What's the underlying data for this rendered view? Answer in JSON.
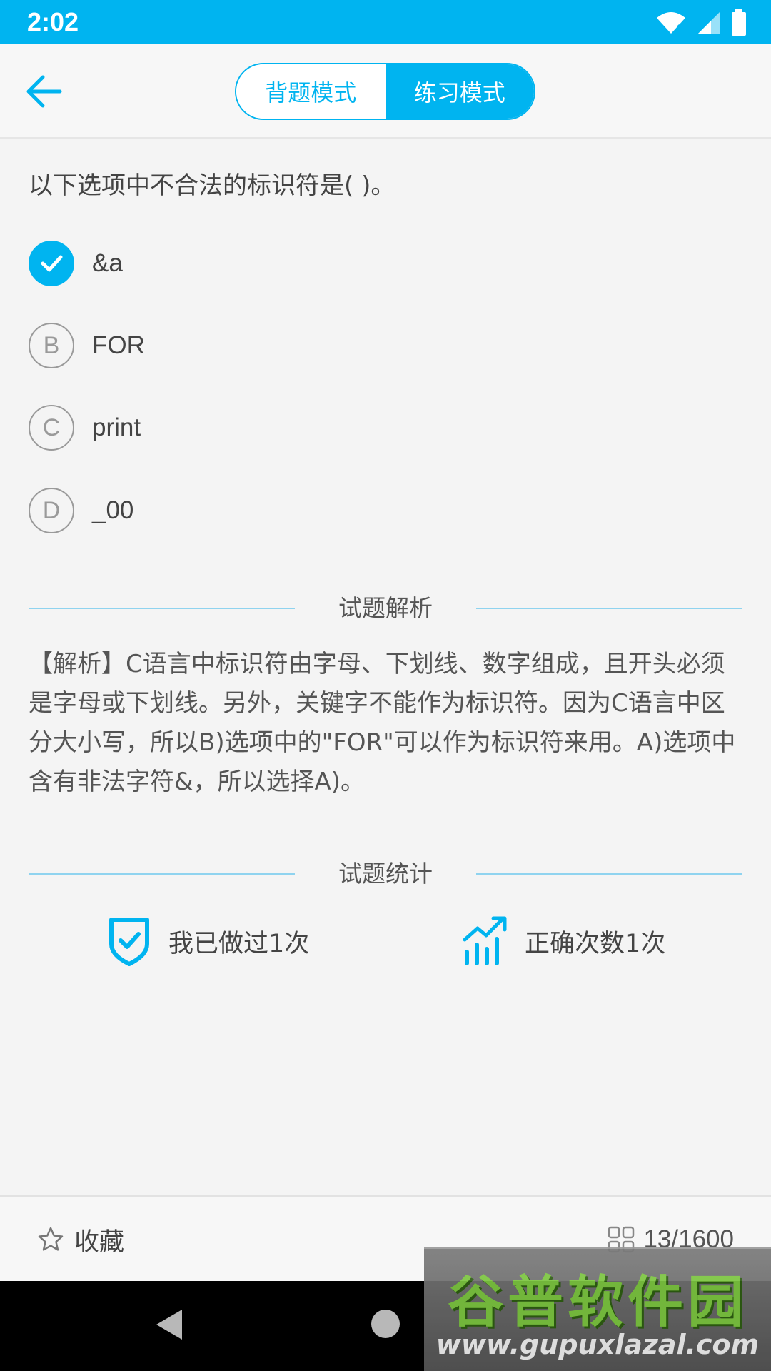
{
  "status_bar": {
    "time": "2:02"
  },
  "header": {
    "tabs": [
      {
        "label": "背题模式",
        "active": false
      },
      {
        "label": "练习模式",
        "active": true
      }
    ]
  },
  "question": {
    "text": "以下选项中不合法的标识符是(        )。",
    "options": [
      {
        "letter": "A",
        "text": "&a",
        "checked": true
      },
      {
        "letter": "B",
        "text": "FOR",
        "checked": false
      },
      {
        "letter": "C",
        "text": "print",
        "checked": false
      },
      {
        "letter": "D",
        "text": "_00",
        "checked": false
      }
    ]
  },
  "analysis": {
    "title": "试题解析",
    "text": "【解析】C语言中标识符由字母、下划线、数字组成，且开头必须是字母或下划线。另外，关键字不能作为标识符。因为C语言中区分大小写，所以B)选项中的\"FOR\"可以作为标识符来用。A)选项中含有非法字符&，所以选择A)。"
  },
  "stats": {
    "title": "试题统计",
    "done": "我已做过1次",
    "correct": "正确次数1次"
  },
  "bottom": {
    "favorite": "收藏",
    "progress": "13/1600"
  },
  "watermark": {
    "title": "谷普软件园",
    "url": "www.gupuxlazal.com"
  },
  "colors": {
    "accent": "#00b4f0",
    "background": "#f4f4f4"
  }
}
